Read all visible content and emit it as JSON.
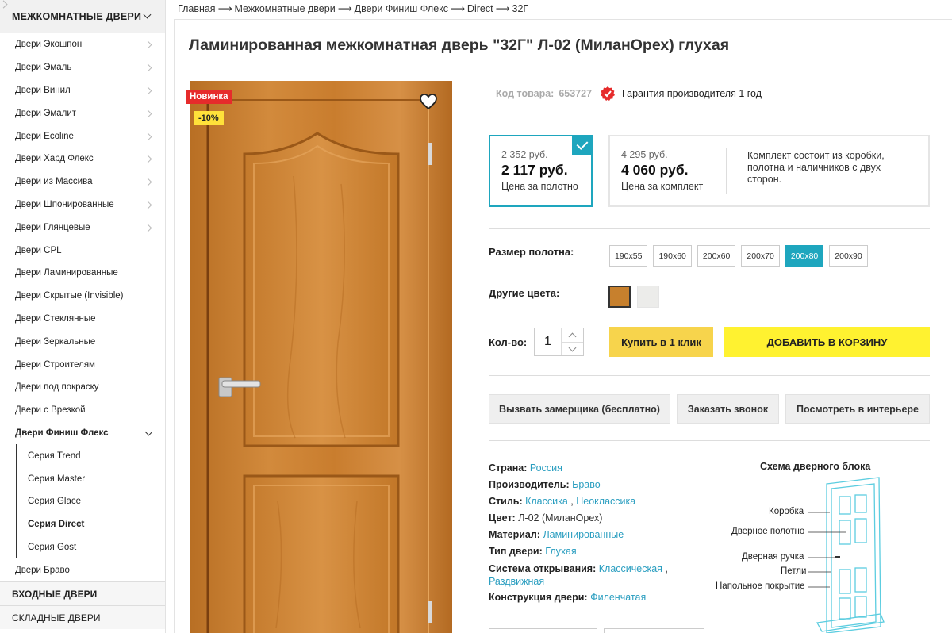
{
  "sidebar": {
    "header": "МЕЖКОМНАТНЫЕ ДВЕРИ",
    "items": [
      {
        "label": "Двери Экошпон"
      },
      {
        "label": "Двери Эмаль"
      },
      {
        "label": "Двери Винил"
      },
      {
        "label": "Двери Эмалит"
      },
      {
        "label": "Двери Ecoline"
      },
      {
        "label": "Двери Хард Флекс"
      },
      {
        "label": "Двери из Массива"
      },
      {
        "label": "Двери Шпонированные"
      },
      {
        "label": "Двери Глянцевые"
      },
      {
        "label": "Двери CPL"
      },
      {
        "label": "Двери Ламинированные"
      },
      {
        "label": "Двери Скрытые (Invisible)"
      },
      {
        "label": "Двери Стеклянные"
      },
      {
        "label": "Двери Зеркальные"
      },
      {
        "label": "Двери Строителям"
      },
      {
        "label": "Двери под покраску"
      },
      {
        "label": "Двери с Врезкой"
      },
      {
        "label": "Двери Финиш Флекс"
      }
    ],
    "sub_items": [
      {
        "label": "Серия Trend"
      },
      {
        "label": "Серия Master"
      },
      {
        "label": "Серия Glace"
      },
      {
        "label": "Серия Direct"
      },
      {
        "label": "Серия Gost"
      }
    ],
    "after_item": "Двери Браво",
    "categories": [
      "ВХОДНЫЕ ДВЕРИ",
      "СКЛАДНЫЕ ДВЕРИ"
    ]
  },
  "breadcrumb": [
    "Главная",
    "Межкомнатные двери",
    "Двери Финиш Флекс",
    "Direct",
    "32Г"
  ],
  "breadcrumb_sep": "⟶",
  "product": {
    "title": "Ламинированная межкомнатная дверь \"32Г\" Л-02 (МиланОрех) глухая",
    "badge_new": "Новинка",
    "badge_discount": "-10%",
    "code_label": "Код товара:",
    "code": "653727",
    "warranty": "Гарантия производителя 1 год"
  },
  "prices": {
    "panel": {
      "old": "2 352 руб.",
      "new": "2 117 руб.",
      "label": "Цена за полотно"
    },
    "set": {
      "old": "4 295 руб.",
      "new": "4 060 руб.",
      "label": "Цена за комплект",
      "desc": "Комплект состоит из коробки, полотна и наличников с двух сторон."
    }
  },
  "size_label": "Размер полотна:",
  "sizes": [
    "190x55",
    "190x60",
    "200x60",
    "200x70",
    "200x80",
    "200x90"
  ],
  "selected_size": "200x80",
  "colors_label": "Другие цвета:",
  "colors": [
    "#c7802d",
    "#ececea"
  ],
  "qty_label": "Кол-во:",
  "qty": "1",
  "buttons": {
    "one_click": "Купить в 1 клик",
    "cart": "ДОБАВИТЬ В КОРЗИНУ",
    "measure": "Вызвать замерщика (бесплатно)",
    "call": "Заказать звонок",
    "interior": "Посмотреть в интерьере"
  },
  "props": [
    {
      "label": "Страна:",
      "values": [
        "Россия"
      ],
      "link": true
    },
    {
      "label": "Производитель:",
      "values": [
        "Браво"
      ],
      "link": true
    },
    {
      "label": "Стиль:",
      "values": [
        "Классика",
        "Неоклассика"
      ],
      "link": true
    },
    {
      "label": "Цвет:",
      "values": [
        "Л-02 (МиланОрех)"
      ],
      "link": false
    },
    {
      "label": "Материал:",
      "values": [
        "Ламинированные"
      ],
      "link": true
    },
    {
      "label": "Тип двери:",
      "values": [
        "Глухая"
      ],
      "link": true
    },
    {
      "label": "Система открывания:",
      "values": [
        "Классическая",
        "Раздвижная"
      ],
      "link": true
    },
    {
      "label": "Конструкция двери:",
      "values": [
        "Филенчатая"
      ],
      "link": true
    }
  ],
  "scheme": {
    "title": "Схема дверного блока",
    "labels": [
      "Коробка",
      "Дверное полотно",
      "Дверная ручка",
      "Петли",
      "Напольное покрытие"
    ]
  },
  "accent_color": "#1ea6be",
  "link_color": "#2a9ec0"
}
